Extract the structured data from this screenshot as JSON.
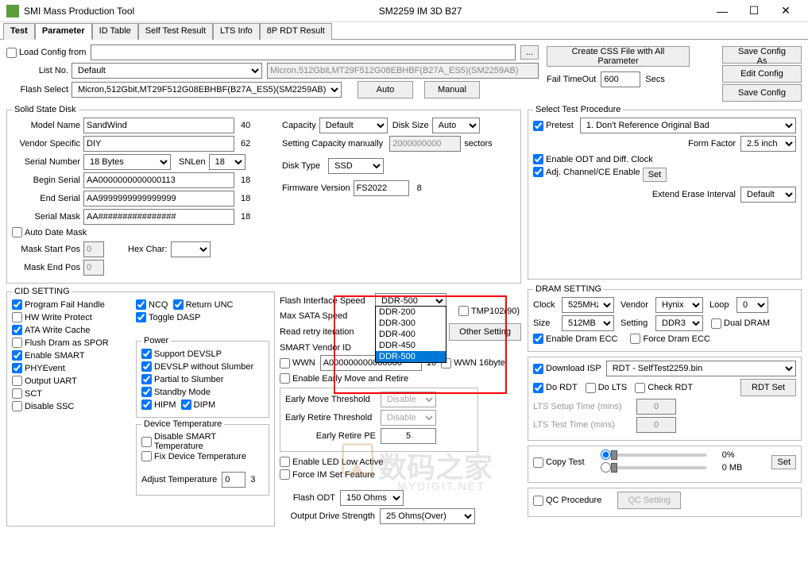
{
  "window": {
    "title": "SMI Mass Production Tool",
    "center": "SM2259 IM 3D B27"
  },
  "tabs": [
    "Test",
    "Parameter",
    "ID Table",
    "Self Test Result",
    "LTS Info",
    "8P RDT Result"
  ],
  "top": {
    "load_config": "Load Config from",
    "list_no": "List No.",
    "list_no_val": "Default",
    "flash_string": "Micron,512Gbit,MT29F512G08EBHBF(B27A_ES5)(SM2259AB)",
    "flash_select": "Flash Select",
    "auto": "Auto",
    "manual": "Manual",
    "create_css": "Create CSS File with All Parameter",
    "save_as": "Save Config As",
    "edit": "Edit Config",
    "save": "Save Config",
    "fail_timeout": "Fail TimeOut",
    "fail_timeout_val": "600",
    "secs": "Secs"
  },
  "ssd": {
    "legend": "Solid State Disk",
    "model_name": "Model Name",
    "model_val": "SandWind",
    "model_len": "40",
    "vendor_specific": "Vendor Specific",
    "vendor_val": "DIY",
    "vendor_len": "62",
    "serial_number": "Serial Number",
    "serial_val": "18 Bytes",
    "snlen": "SNLen",
    "snlen_val": "18",
    "begin_serial": "Begin Serial",
    "begin_val": "AA0000000000000113",
    "begin_len": "18",
    "end_serial": "End Serial",
    "end_val": "AA9999999999999999",
    "end_len": "18",
    "serial_mask": "Serial Mask",
    "mask_val": "AA################",
    "mask_len": "18",
    "auto_date": "Auto Date Mask",
    "mask_start": "Mask Start Pos",
    "mask_start_val": "0",
    "hex_char": "Hex Char:",
    "mask_end": "Mask End Pos",
    "mask_end_val": "0",
    "capacity": "Capacity",
    "capacity_val": "Default",
    "disk_size": "Disk Size",
    "disk_size_val": "Auto",
    "setting_cap": "Setting Capacity manually",
    "setting_cap_val": "2000000000",
    "sectors": "sectors",
    "disk_type": "Disk Type",
    "disk_type_val": "SSD",
    "firmware": "Firmware Version",
    "firmware_val": "FS2022",
    "firmware_len": "8"
  },
  "cid": {
    "legend": "CID SETTING",
    "pfh": "Program Fail Handle",
    "hwwp": "HW Write Protect",
    "awc": "ATA Write Cache",
    "fdspor": "Flush Dram as SPOR",
    "ensmart": "Enable SMART",
    "phy": "PHYEvent",
    "ouart": "Output UART",
    "sct": "SCT",
    "dssc": "Disable SSC",
    "ncq": "NCQ",
    "runc": "Return UNC",
    "tdasp": "Toggle DASP",
    "power": "Power",
    "devslp": "Support DEVSLP",
    "devslp_ns": "DEVSLP without Slumber",
    "pts": "Partial to Slumber",
    "standby": "Standby Mode",
    "hipm": "HIPM",
    "dipm": "DIPM",
    "devtemp": "Device Temperature",
    "dst": "Disable SMART Temperature",
    "fdt": "Fix Device Temperature",
    "adj_temp": "Adjust Temperature",
    "adj_val": "0",
    "adj_suffix": "3"
  },
  "mid": {
    "fis": "Flash Interface Speed",
    "fis_val": "DDR-500",
    "fis_options": [
      "DDR-200",
      "DDR-300",
      "DDR-400",
      "DDR-450",
      "DDR-500"
    ],
    "mss": "Max SATA Speed",
    "rri": "Read retry iteration",
    "svi": "SMART Vendor ID",
    "tmp102": "TMP102(90)",
    "other": "Other Setting",
    "wwn": "WWN",
    "wwn_val": "A000000000000000",
    "wwn_len": "16",
    "wwn16": "WWN 16byte",
    "eemr": "Enable Early Move and Retire",
    "emt": "Early Move Threshold",
    "emt_val": "Disable",
    "ert": "Early Retire Threshold",
    "ert_val": "Disable",
    "erp": "Early Retire PE",
    "erp_val": "5",
    "ella": "Enable LED Low Active",
    "fisf": "Force IM Set Feature",
    "fodt": "Flash ODT",
    "fodt_val": "150 Ohms",
    "ods": "Output Drive Strength",
    "ods_val": "25 Ohms(Over)"
  },
  "stp": {
    "legend": "Select Test Procedure",
    "pretest": "Pretest",
    "pretest_val": "1. Don't Reference Original Bad",
    "form_factor": "Form Factor",
    "form_factor_val": "2.5 inch",
    "eodc": "Enable ODT and Diff. Clock",
    "acce": "Adj. Channel/CE Enable",
    "set": "Set",
    "eei": "Extend Erase Interval",
    "eei_val": "Default"
  },
  "dram": {
    "legend": "DRAM SETTING",
    "clock": "Clock",
    "clock_val": "525MHz",
    "vendor": "Vendor",
    "vendor_val": "Hynix",
    "loop": "Loop",
    "loop_val": "0",
    "size": "Size",
    "size_val": "512MB",
    "setting": "Setting",
    "setting_val": "DDR3",
    "dual": "Dual DRAM",
    "edecc": "Enable Dram ECC",
    "fdecc": "Force Dram ECC"
  },
  "isp": {
    "dl_isp": "Download ISP",
    "isp_val": "RDT - SelfTest2259.bin",
    "do_rdt": "Do RDT",
    "do_lts": "Do LTS",
    "check_rdt": "Check RDT",
    "rdt_set": "RDT Set",
    "lts_setup": "LTS Setup Time (mins)",
    "lts_setup_val": "0",
    "lts_test": "LTS Test Time (mins)",
    "lts_test_val": "0",
    "copy_test": "Copy Test",
    "pct": "0%",
    "mb": "0 MB",
    "set": "Set",
    "qc_proc": "QC Procedure",
    "qc_setting": "QC Setting"
  }
}
